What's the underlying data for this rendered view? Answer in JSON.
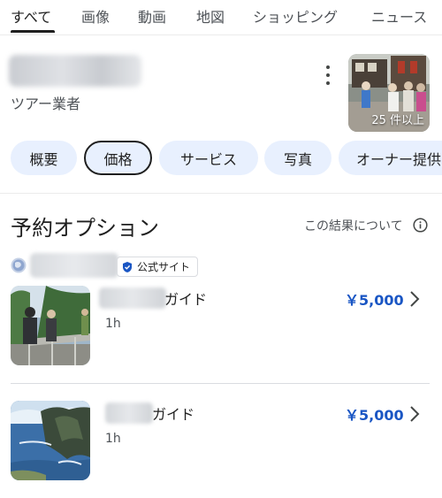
{
  "tabs": [
    {
      "label": "すべて",
      "active": true
    },
    {
      "label": "画像",
      "active": false
    },
    {
      "label": "動画",
      "active": false
    },
    {
      "label": "地図",
      "active": false
    },
    {
      "label": "ショッピング",
      "active": false
    },
    {
      "label": "ニュース",
      "active": false
    }
  ],
  "business": {
    "category": "ツアー業者",
    "photo_count": "25 件以上"
  },
  "chips": [
    {
      "label": "概要",
      "selected": false
    },
    {
      "label": "価格",
      "selected": true
    },
    {
      "label": "サービス",
      "selected": false
    },
    {
      "label": "写真",
      "selected": false
    },
    {
      "label": "オーナー提供",
      "selected": false
    }
  ],
  "booking": {
    "title": "予約オプション",
    "about_link": "この結果について",
    "official_badge": "公式サイト",
    "offers": [
      {
        "name_suffix": "ガイド",
        "duration": "1h",
        "price": "￥5,000"
      },
      {
        "name_suffix": "ガイド",
        "duration": "1h",
        "price": "￥5,000"
      }
    ]
  },
  "colors": {
    "accent_blue": "#1a56c4",
    "chip_bg": "#e8f0fe",
    "text_secondary": "#4d5156"
  }
}
